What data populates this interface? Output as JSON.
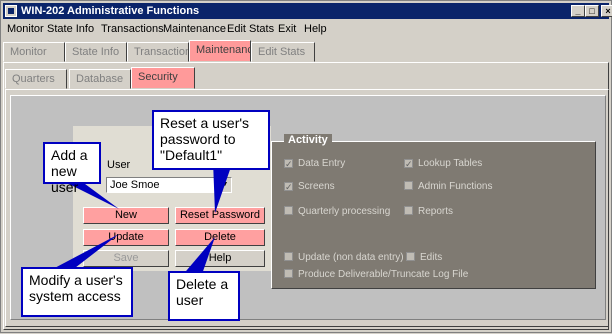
{
  "window": {
    "title": "WIN-202 Administrative Functions",
    "controls": [
      "_",
      "□",
      "×"
    ]
  },
  "menu": [
    "Monitor",
    "State Info",
    "Transactions",
    "Maintenance",
    "Edit Stats",
    "Exit",
    "Help"
  ],
  "main_tabs": [
    "Monitor",
    "State Info",
    "Transaction",
    "Maintenanc",
    "Edit Stats"
  ],
  "sub_tabs": [
    "Quarters",
    "Database",
    "Security"
  ],
  "form": {
    "user_label": "User",
    "user_value": "Joe Smoe",
    "new_label": "New",
    "reset_label": "Reset Password",
    "update_label": "Update",
    "delete_label": "Delete",
    "save_label": "Save",
    "help_label": "Help"
  },
  "activity": {
    "title": "Activity",
    "data_entry": "Data Entry",
    "lookup_tables": "Lookup Tables",
    "screens": "Screens",
    "admin_functions": "Admin Functions",
    "quarterly_processing": "Quarterly processing",
    "reports": "Reports",
    "update_non_data_entry": "Update (non data entry)",
    "edits": "Edits",
    "produce_deliverable": "Produce Deliverable/Truncate Log File"
  },
  "callouts": {
    "add": "Add a new user",
    "reset": "Reset a user's password to \"Default1\"",
    "modify": "Modify a user's system access",
    "delete": "Delete a user"
  },
  "colors": {
    "active_tab": "#ff9a9a",
    "button_pink": "#ffa0a0",
    "activity_bg": "#7f7a72",
    "callout_border": "#0000c0",
    "titlebar": "#0a246a"
  }
}
